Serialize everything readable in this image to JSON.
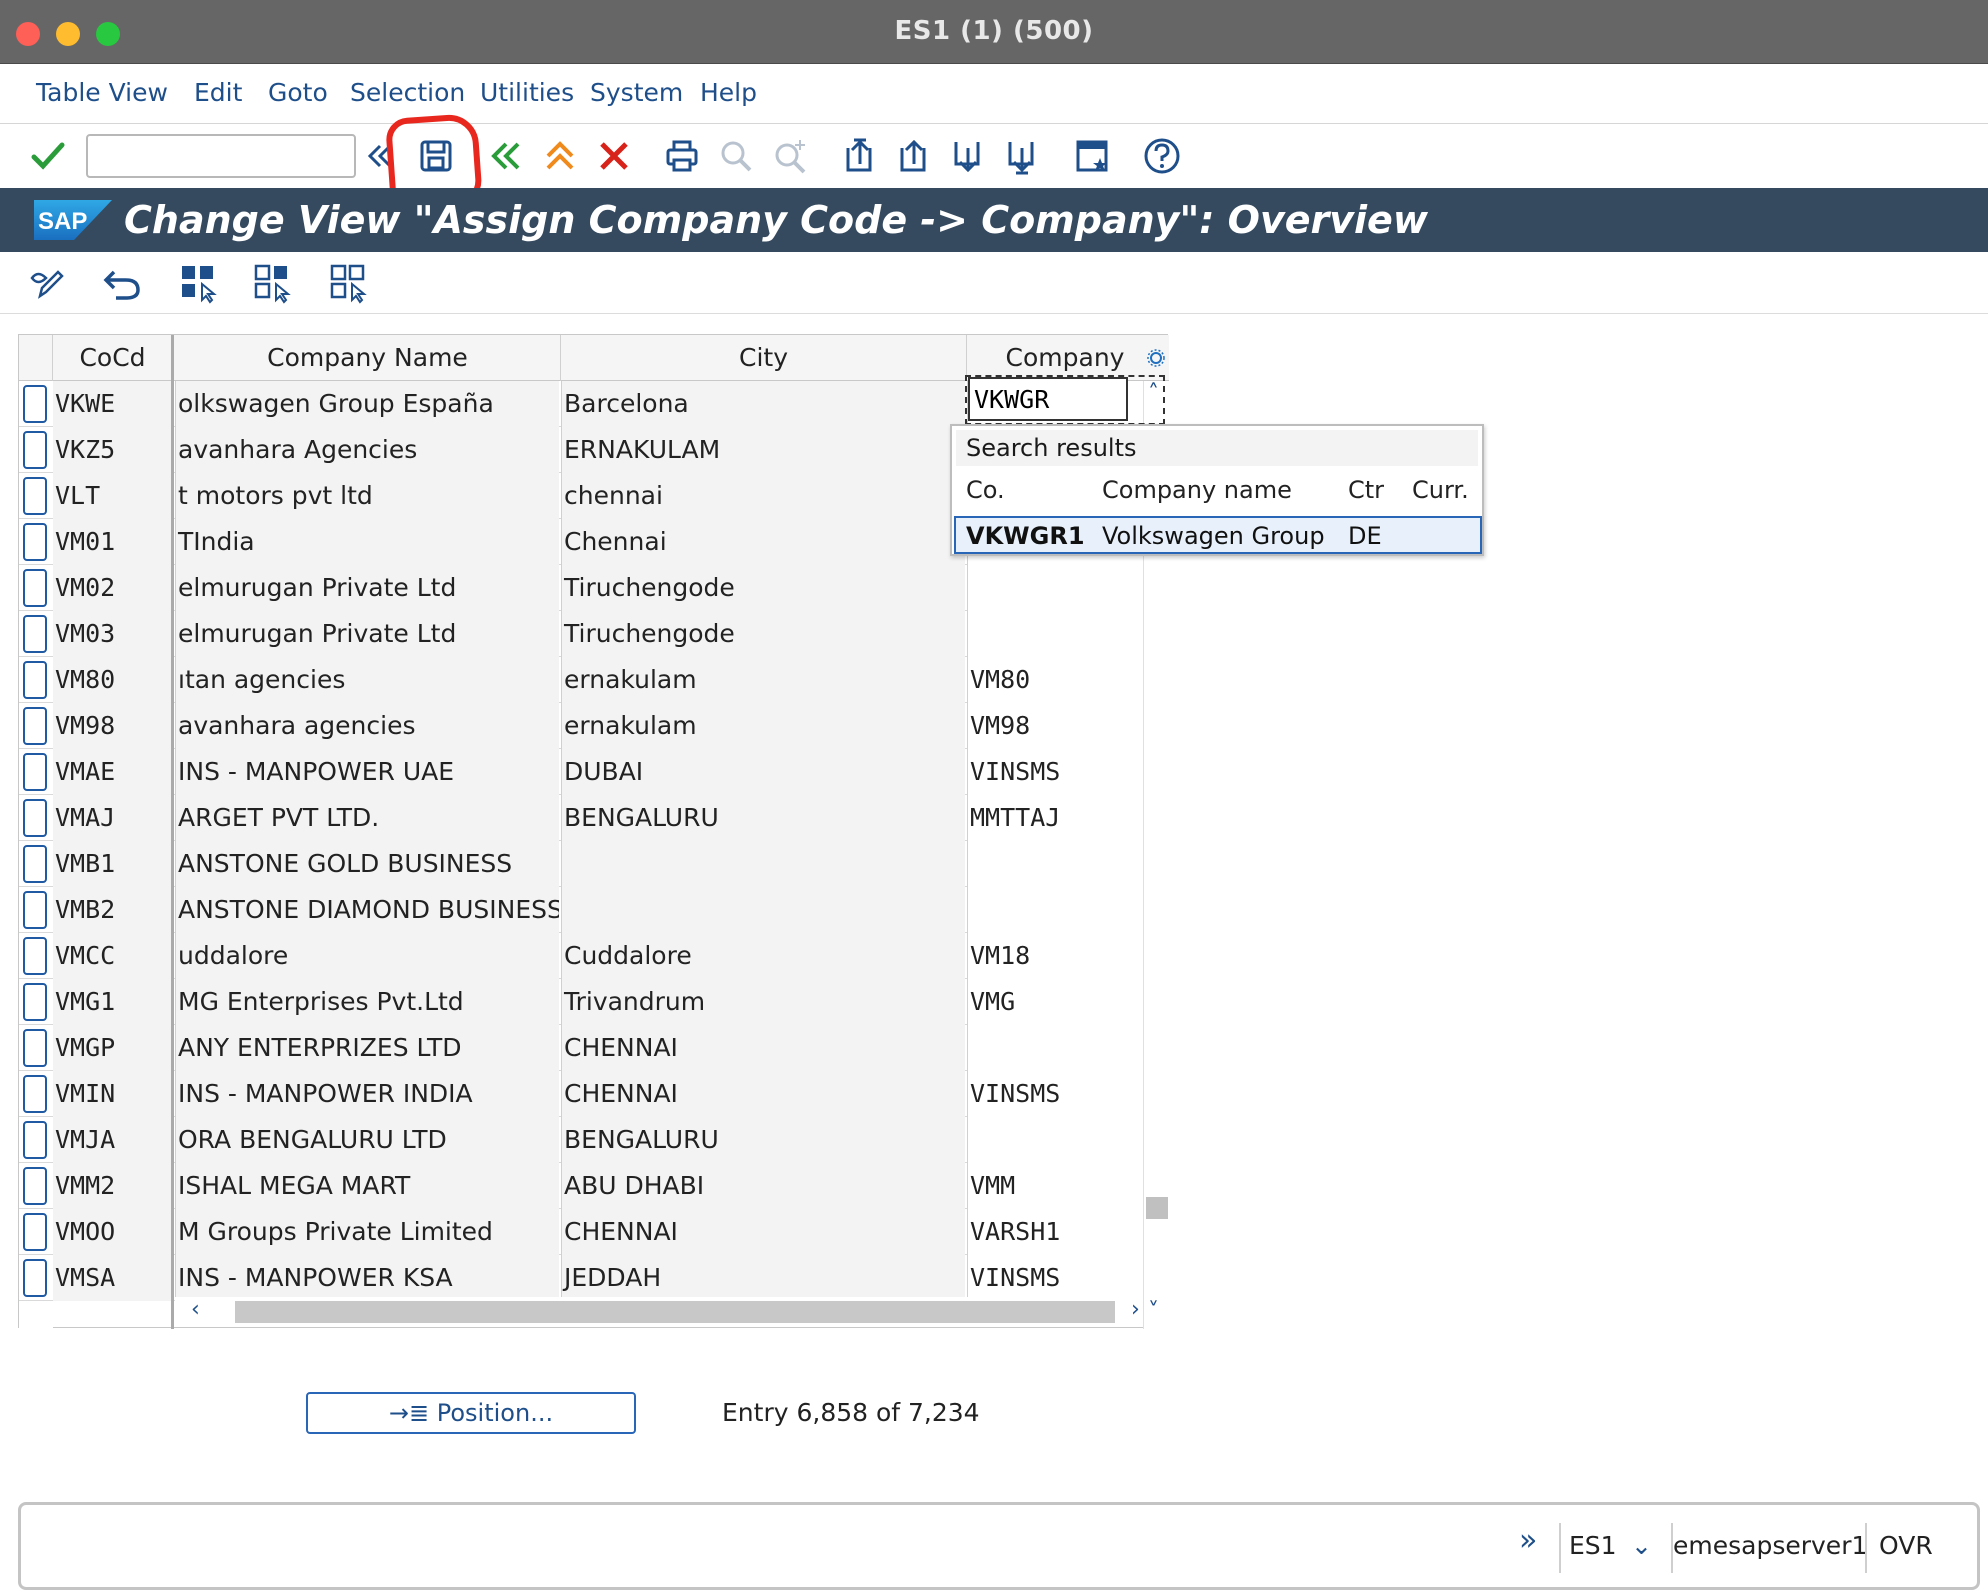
{
  "window": {
    "title": "ES1 (1) (500)"
  },
  "menu": [
    "Table View",
    "Edit",
    "Goto",
    "Selection",
    "Utilities",
    "System",
    "Help"
  ],
  "toolbar": {
    "command_value": "",
    "icons": [
      "enter-icon",
      "back-double-icon",
      "save-icon",
      "back-icon",
      "exit-icon",
      "cancel-icon",
      "print-icon",
      "find-icon",
      "find-next-icon",
      "first-page-icon",
      "previous-page-icon",
      "next-page-icon",
      "last-page-icon",
      "create-session-icon",
      "help-icon"
    ]
  },
  "titleband": {
    "logo": "SAP",
    "title": "Change View \"Assign Company Code -> Company\": Overview"
  },
  "apptoolbar": {
    "icons": [
      "display-change-icon",
      "undo-icon",
      "select-all-icon",
      "select-block-icon",
      "deselect-all-icon"
    ]
  },
  "table": {
    "headers": {
      "code": "CoCd",
      "name": "Company Name",
      "city": "City",
      "company": "Company"
    },
    "active_input_value": "VKWGR",
    "rows": [
      {
        "code": "VKWE",
        "name": "olkswagen Group España",
        "city": "Barcelona",
        "company": ""
      },
      {
        "code": "VKZ5",
        "name": "avanhara Agencies",
        "city": "ERNAKULAM",
        "company": ""
      },
      {
        "code": "VLT",
        "name": "t motors pvt ltd",
        "city": "chennai",
        "company": ""
      },
      {
        "code": "VM01",
        "name": "TIndia",
        "city": "Chennai",
        "company": ""
      },
      {
        "code": "VM02",
        "name": "elmurugan Private Ltd",
        "city": "Tiruchengode",
        "company": ""
      },
      {
        "code": "VM03",
        "name": "elmurugan Private Ltd",
        "city": "Tiruchengode",
        "company": ""
      },
      {
        "code": "VM80",
        "name": "ıtan agencies",
        "city": "ernakulam",
        "company": "VM80"
      },
      {
        "code": "VM98",
        "name": "avanhara agencies",
        "city": "ernakulam",
        "company": "VM98"
      },
      {
        "code": "VMAE",
        "name": "INS - MANPOWER UAE",
        "city": "DUBAI",
        "company": "VINSMS"
      },
      {
        "code": "VMAJ",
        "name": "ARGET PVT LTD.",
        "city": "BENGALURU",
        "company": "MMTTAJ"
      },
      {
        "code": "VMB1",
        "name": "ANSTONE GOLD BUSINESS",
        "city": "",
        "company": ""
      },
      {
        "code": "VMB2",
        "name": "ANSTONE DIAMOND BUSINESS",
        "city": "",
        "company": ""
      },
      {
        "code": "VMCC",
        "name": "uddalore",
        "city": "Cuddalore",
        "company": "VM18"
      },
      {
        "code": "VMG1",
        "name": "MG Enterprises Pvt.Ltd",
        "city": "Trivandrum",
        "company": "VMG"
      },
      {
        "code": "VMGP",
        "name": "ANY ENTERPRIZES LTD",
        "city": "CHENNAI",
        "company": ""
      },
      {
        "code": "VMIN",
        "name": "INS - MANPOWER INDIA",
        "city": "CHENNAI",
        "company": "VINSMS"
      },
      {
        "code": "VMJA",
        "name": "ORA BENGALURU LTD",
        "city": "BENGALURU",
        "company": ""
      },
      {
        "code": "VMM2",
        "name": "ISHAL MEGA MART",
        "city": "ABU DHABI",
        "company": "VMM"
      },
      {
        "code": "VMOO",
        "name": "M Groups Private Limited",
        "city": "CHENNAI",
        "company": "VARSH1"
      },
      {
        "code": "VMSA",
        "name": "INS - MANPOWER KSA",
        "city": "JEDDAH",
        "company": "VINSMS"
      }
    ]
  },
  "search_popup": {
    "title": "Search results",
    "headers": {
      "co": "Co.",
      "name": "Company name",
      "ctr": "Ctr",
      "curr": "Curr."
    },
    "result": {
      "co": "VKWGR1",
      "name": "Volkswagen Group",
      "ctr": "DE",
      "curr": ""
    }
  },
  "footer": {
    "position_button": "Position...",
    "entry_text": "Entry 6,858 of 7,234"
  },
  "statusbar": {
    "system": "ES1",
    "server": "emesapserver1",
    "mode": "OVR"
  },
  "colors": {
    "title_band": "#354a5f",
    "link_blue": "#1f4f8a",
    "highlight_red": "#e8271e",
    "enter_green": "#2a9d3a"
  }
}
